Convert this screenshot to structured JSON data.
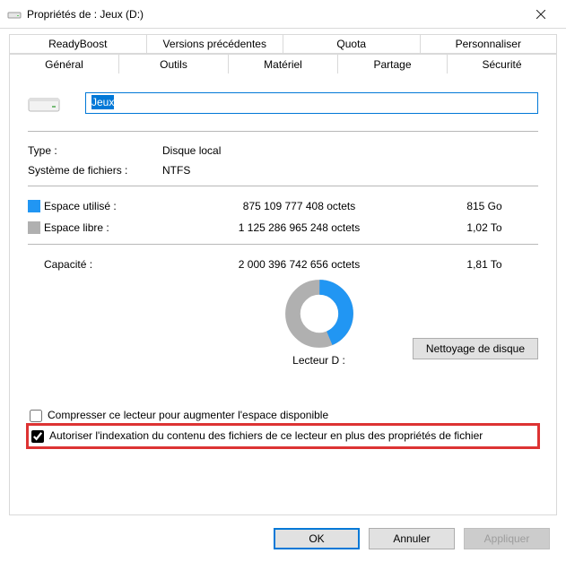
{
  "window": {
    "title": "Propriétés de : Jeux (D:)"
  },
  "tabs": {
    "row1": [
      "ReadyBoost",
      "Versions précédentes",
      "Quota",
      "Personnaliser"
    ],
    "row2": [
      "Général",
      "Outils",
      "Matériel",
      "Partage",
      "Sécurité"
    ],
    "active": "Général"
  },
  "general": {
    "name_value": "Jeux",
    "type_label": "Type :",
    "type_value": "Disque local",
    "fs_label": "Système de fichiers :",
    "fs_value": "NTFS",
    "used_label": "Espace utilisé :",
    "used_bytes": "875 109 777 408 octets",
    "used_human": "815 Go",
    "free_label": "Espace libre :",
    "free_bytes": "1 125 286 965 248 octets",
    "free_human": "1,02 To",
    "capacity_label": "Capacité :",
    "capacity_bytes": "2 000 396 742 656 octets",
    "capacity_human": "1,81 To",
    "drive_label": "Lecteur D :",
    "cleanup_button": "Nettoyage de disque",
    "compress_label": "Compresser ce lecteur pour augmenter l'espace disponible",
    "index_label": "Autoriser l'indexation du contenu des fichiers de ce lecteur en plus des propriétés de fichier"
  },
  "buttons": {
    "ok": "OK",
    "cancel": "Annuler",
    "apply": "Appliquer"
  },
  "chart_data": {
    "type": "pie",
    "title": "Lecteur D :",
    "series": [
      {
        "name": "Espace utilisé",
        "value": 875109777408,
        "color": "#2196f3"
      },
      {
        "name": "Espace libre",
        "value": 1125286965248,
        "color": "#b0b0b0"
      }
    ]
  }
}
